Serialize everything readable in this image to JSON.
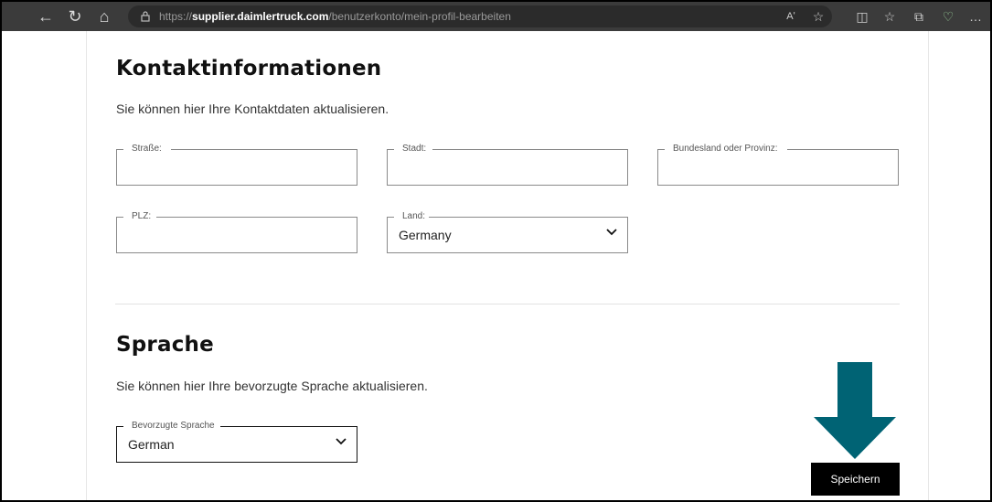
{
  "browser": {
    "url_prefix": "https://",
    "url_host": "supplier.daimlertruck.com",
    "url_path": "/benutzerkonto/mein-profil-bearbeiten",
    "read_aloud_label": "Aʹ",
    "more_label": "…"
  },
  "contact": {
    "title": "Kontaktinformationen",
    "description": "Sie können hier Ihre Kontaktdaten aktualisieren.",
    "street": {
      "label": "Straße:",
      "value": ""
    },
    "city": {
      "label": "Stadt:",
      "value": ""
    },
    "state": {
      "label": "Bundesland oder Provinz:",
      "value": ""
    },
    "zip": {
      "label": "PLZ:",
      "value": ""
    },
    "country": {
      "label": "Land:",
      "value": "Germany"
    }
  },
  "language": {
    "title": "Sprache",
    "description": "Sie können hier Ihre bevorzugte Sprache aktualisieren.",
    "preferred": {
      "label": "Bevorzugte Sprache",
      "value": "German"
    }
  },
  "save_label": "Speichern",
  "colors": {
    "arrow": "#006374",
    "button": "#000000",
    "browser_bar": "#3b3b3b"
  }
}
